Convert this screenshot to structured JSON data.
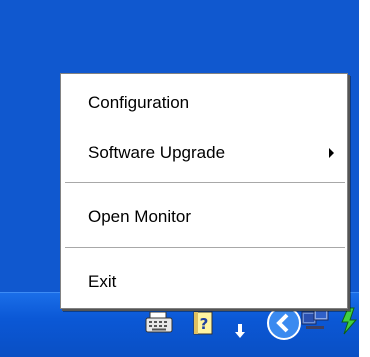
{
  "menu": {
    "items": [
      {
        "label": "Configuration",
        "has_submenu": false
      },
      {
        "label": "Software Upgrade",
        "has_submenu": true
      },
      {
        "label": "Open Monitor",
        "has_submenu": false
      },
      {
        "label": "Exit",
        "has_submenu": false
      }
    ]
  },
  "tray": {
    "icons": [
      "keyboard-icon",
      "help-icon",
      "transfer-arrows-icon",
      "show-hidden-icons-chevron",
      "network-icon",
      "green-app-icon"
    ]
  },
  "colors": {
    "desktop": "#1058cf",
    "menu_background": "#ffffff",
    "separator": "#a8a8a8"
  }
}
